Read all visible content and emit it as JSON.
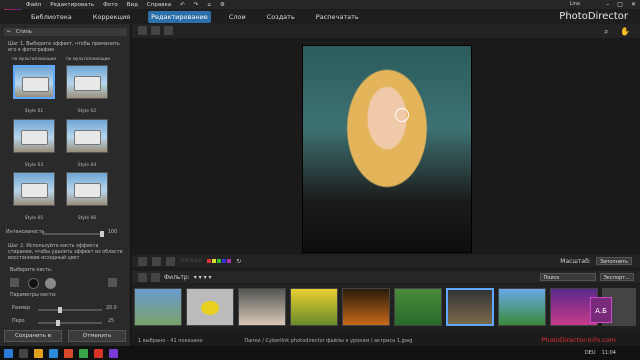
{
  "menu": [
    "Файл",
    "Редактировать",
    "Фото",
    "Вид",
    "Справка"
  ],
  "user": "Lina",
  "nav": [
    "Библиотека",
    "Коррекция",
    "Редактирование",
    "Слои",
    "Создать",
    "Распечатать"
  ],
  "brand": "PhotoDirector",
  "panel": {
    "header": "Стиль",
    "step1": "Шаг 1. Выберите эффект, чтобы применить его к фотографии",
    "tabs": [
      "по мультипликации",
      "по мультипликации"
    ],
    "styles": [
      "Style 01",
      "Style 02",
      "Style 03",
      "Style 04",
      "Style 05",
      "Style 06"
    ],
    "intensity_label": "Интенсивность",
    "intensity_value": "100",
    "step2": "Шаг 2. Используйте кисть эффекта стирания, чтобы удалить эффект из области восстановив исходный цвет",
    "brush_label": "Выберите кисть:",
    "brush_params": "Параметры кисти:",
    "size_label": "Размер",
    "size_value": "20.0",
    "feather_label": "Перо",
    "feather_value": "25",
    "save_btn": "Сохранить в",
    "cancel_btn": "Отменить"
  },
  "viewer": {
    "zoom_label": "Масштаб:",
    "zoom_value": "Заполнить"
  },
  "filter": {
    "label": "Фильтр:",
    "search_placeholder": "Поиск",
    "export": "Экспорт..."
  },
  "status": "1 выбрано - 41 показано",
  "path": "Папки / Cyberlink photodirector файлы к урокам / актриса 1.jpeg",
  "taskbar": {
    "lang": "DEU",
    "time": "11:04"
  },
  "watermark": "PhotoDirector-Info.com"
}
